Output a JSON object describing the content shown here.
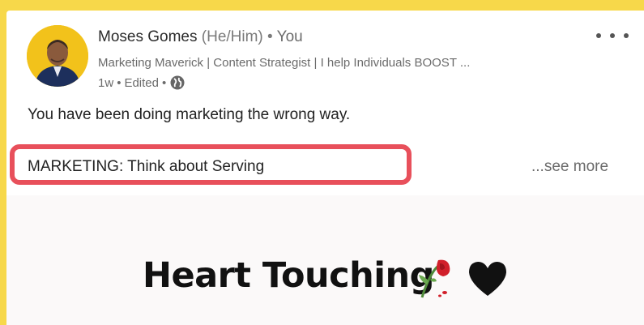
{
  "author": {
    "name": "Moses Gomes",
    "pronouns": "(He/Him)",
    "separator": "•",
    "relation": "You",
    "headline": "Marketing Maverick | Content Strategist | I help Individuals BOOST ...",
    "timestamp": "1w",
    "edited": "Edited",
    "visibility_icon": "globe-icon"
  },
  "post": {
    "line1": "You have been doing marketing the wrong way.",
    "line2": "MARKETING: Think about Serving",
    "see_more": "...see more",
    "highlight_color": "#e8505b"
  },
  "media": {
    "title": "Heart Touching",
    "icons": [
      "wilted-rose-icon",
      "black-heart-icon"
    ]
  },
  "colors": {
    "page_background": "#f7d84a",
    "card_background": "#ffffff"
  }
}
